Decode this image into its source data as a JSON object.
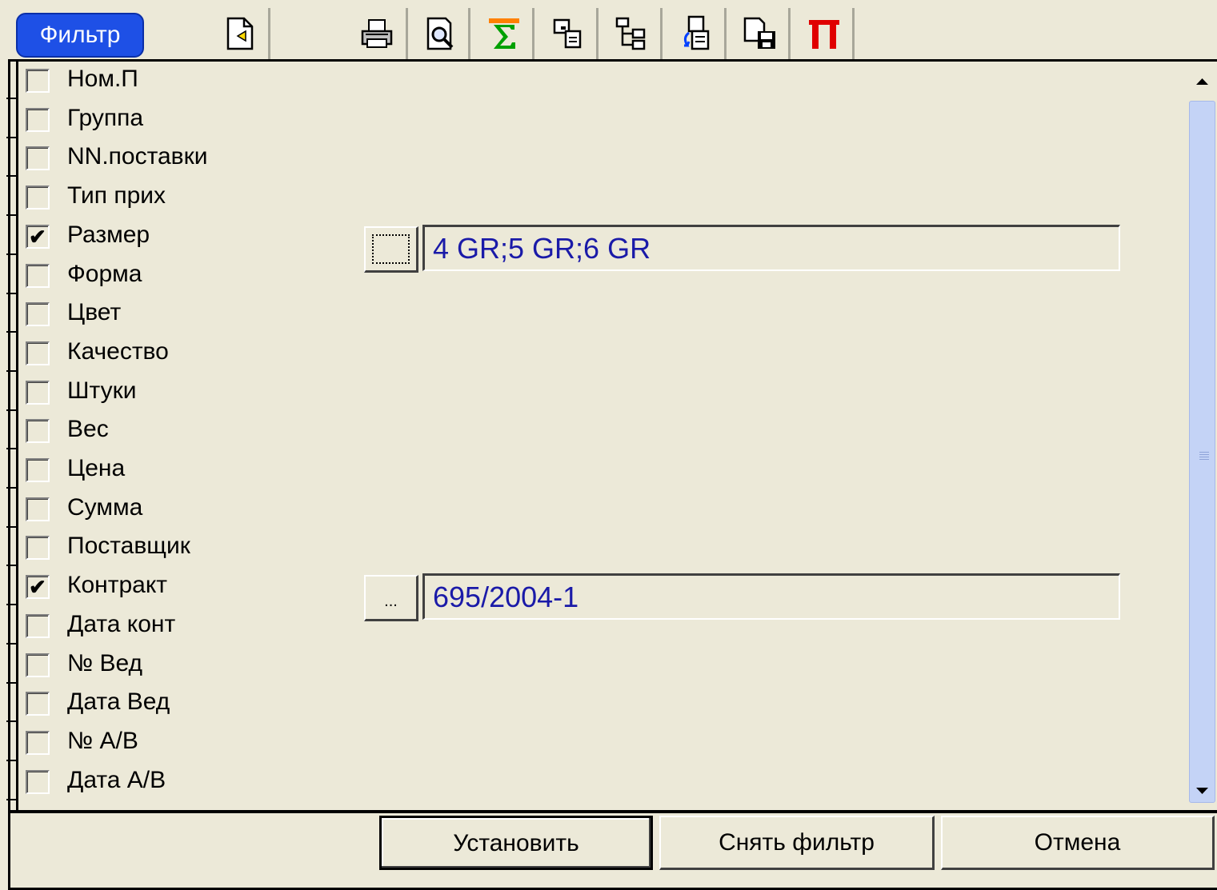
{
  "toolbar": {
    "filter_label": "Фильтр",
    "buttons": [
      {
        "icon": "new-document-icon"
      },
      {
        "icon": "print-icon"
      },
      {
        "icon": "print-preview-icon"
      },
      {
        "icon": "sum-icon"
      },
      {
        "icon": "copy-icon"
      },
      {
        "icon": "tree-icon"
      },
      {
        "icon": "import-icon"
      },
      {
        "icon": "save-icon"
      },
      {
        "icon": "pi-icon",
        "glyph": "П",
        "color": "#e00000"
      }
    ]
  },
  "fields": [
    {
      "label": "Ном.П",
      "checked": false
    },
    {
      "label": "Группа",
      "checked": false
    },
    {
      "label": "NN.поставки",
      "checked": false
    },
    {
      "label": "Тип прих",
      "checked": false
    },
    {
      "label": "Размер",
      "checked": true
    },
    {
      "label": "Форма",
      "checked": false
    },
    {
      "label": "Цвет",
      "checked": false
    },
    {
      "label": "Качество",
      "checked": false
    },
    {
      "label": "Штуки",
      "checked": false
    },
    {
      "label": "Вес",
      "checked": false
    },
    {
      "label": "Цена",
      "checked": false
    },
    {
      "label": "Сумма",
      "checked": false
    },
    {
      "label": "Поставщик",
      "checked": false
    },
    {
      "label": "Контракт",
      "checked": true
    },
    {
      "label": "Дата конт",
      "checked": false
    },
    {
      "label": "№ Вед",
      "checked": false
    },
    {
      "label": "Дата Вед",
      "checked": false
    },
    {
      "label": "№ А/В",
      "checked": false
    },
    {
      "label": "Дата А/В",
      "checked": false
    }
  ],
  "values": {
    "size_value": "4 GR;5 GR;6 GR",
    "contract_value": "695/2004-1",
    "ellipsis": "..."
  },
  "actions": {
    "set_label": "Установить",
    "clear_label": "Снять фильтр",
    "cancel_label": "Отмена"
  },
  "colors": {
    "filter_bg": "#1e50e6",
    "value_text": "#1a1aa8",
    "window_bg": "#ece9d8"
  }
}
